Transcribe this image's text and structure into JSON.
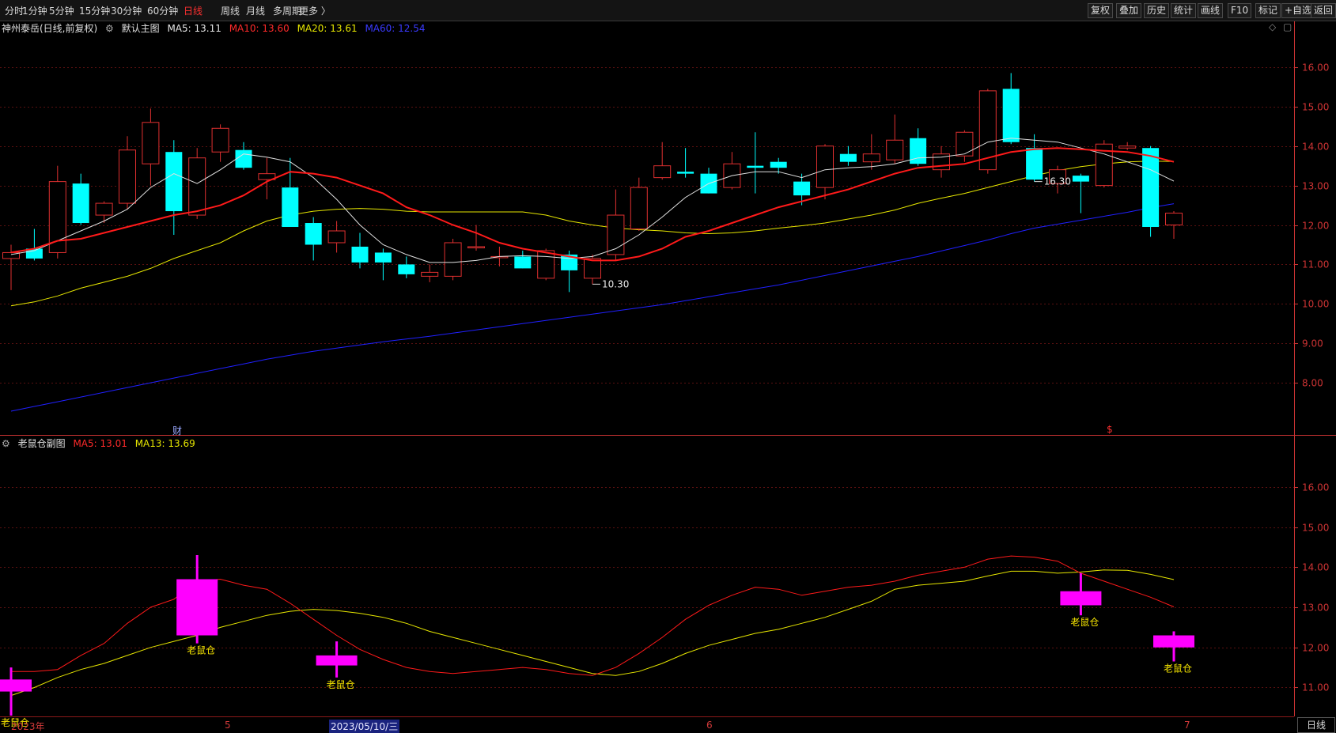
{
  "toolbar": {
    "left_items": [
      "分时",
      "1分钟",
      "5分钟",
      "15分钟",
      "30分钟",
      "60分钟",
      "日线",
      "周线",
      "月线",
      "多周期",
      "更多 〉"
    ],
    "active_index": 6,
    "right_items": [
      "复权",
      "叠加",
      "历史",
      "统计",
      "画线",
      "F10",
      "标记",
      "+自选",
      "返回"
    ]
  },
  "main_info": {
    "stock": "神州泰岳(日线,前复权)",
    "view": "默认主图",
    "ma5": "MA5: 13.11",
    "ma10": "MA10: 13.60",
    "ma20": "MA20: 13.61",
    "ma60": "MA60: 12.54"
  },
  "sub_info": {
    "name": "老鼠仓副图",
    "ma5": "MA5: 13.01",
    "ma13": "MA13: 13.69"
  },
  "markers": {
    "cai": "财",
    "dollar": "$"
  },
  "datebar": {
    "labels": [
      "2023年",
      "5",
      "2023/05/10/三",
      "6",
      "7"
    ],
    "right_button": "日线"
  },
  "colors": {
    "up": "#e03030",
    "down": "#00ffff",
    "ma5": "#e0e0e0",
    "ma10": "#ff1a1a",
    "ma20": "#e6e600",
    "ma60": "#2020ff",
    "signal": "#ff00ff",
    "axis": "#cc3333",
    "signal_text": "#f5e400"
  },
  "chart_data": [
    {
      "type": "candlestick",
      "y_range": [
        7.0,
        16.7
      ],
      "y_ticks": [
        "16.00",
        "15.00",
        "14.00",
        "13.00",
        "12.00",
        "11.00",
        "10.00",
        "9.00",
        "8.00"
      ],
      "grid": true,
      "annotations": [
        {
          "index": 44,
          "label": "16.30"
        },
        {
          "index": 25,
          "label": "10.30"
        }
      ],
      "candles": [
        [
          11.15,
          11.5,
          10.35,
          11.3
        ],
        [
          11.4,
          11.9,
          11.1,
          11.15
        ],
        [
          11.3,
          13.5,
          11.15,
          13.1
        ],
        [
          13.05,
          13.3,
          12.0,
          12.05
        ],
        [
          12.25,
          12.6,
          12.05,
          12.55
        ],
        [
          12.55,
          14.25,
          12.4,
          13.9
        ],
        [
          13.55,
          14.95,
          13.0,
          14.6
        ],
        [
          13.85,
          14.15,
          11.75,
          12.35
        ],
        [
          12.25,
          13.95,
          12.15,
          13.7
        ],
        [
          13.85,
          14.55,
          13.6,
          14.45
        ],
        [
          13.9,
          14.1,
          13.4,
          13.45
        ],
        [
          13.15,
          13.7,
          12.65,
          13.3
        ],
        [
          12.95,
          13.7,
          11.95,
          11.95
        ],
        [
          12.05,
          12.2,
          11.1,
          11.5
        ],
        [
          11.55,
          12.1,
          11.3,
          11.85
        ],
        [
          11.45,
          11.8,
          10.9,
          11.05
        ],
        [
          11.3,
          11.4,
          10.6,
          11.05
        ],
        [
          11.0,
          11.2,
          10.65,
          10.75
        ],
        [
          10.7,
          11.0,
          10.55,
          10.8
        ],
        [
          10.7,
          11.65,
          10.6,
          11.55
        ],
        [
          11.45,
          12.0,
          11.35,
          11.45
        ],
        [
          11.2,
          11.45,
          10.95,
          11.2
        ],
        [
          11.2,
          11.35,
          10.9,
          10.9
        ],
        [
          10.65,
          11.4,
          10.6,
          11.35
        ],
        [
          11.25,
          11.35,
          10.3,
          10.85
        ],
        [
          10.65,
          11.25,
          10.5,
          11.15
        ],
        [
          11.25,
          12.9,
          11.1,
          12.25
        ],
        [
          11.9,
          13.2,
          11.85,
          12.95
        ],
        [
          13.2,
          14.1,
          13.15,
          13.5
        ],
        [
          13.35,
          13.95,
          13.2,
          13.3
        ],
        [
          13.3,
          13.45,
          12.8,
          12.8
        ],
        [
          12.95,
          13.85,
          12.9,
          13.55
        ],
        [
          13.5,
          14.35,
          12.8,
          13.45
        ],
        [
          13.6,
          13.7,
          13.3,
          13.45
        ],
        [
          13.1,
          13.3,
          12.5,
          12.75
        ],
        [
          12.95,
          14.05,
          12.65,
          14.0
        ],
        [
          13.8,
          14.0,
          13.5,
          13.6
        ],
        [
          13.6,
          14.3,
          13.4,
          13.8
        ],
        [
          13.65,
          14.8,
          13.55,
          14.15
        ],
        [
          14.2,
          14.45,
          13.5,
          13.55
        ],
        [
          13.4,
          14.0,
          13.2,
          13.8
        ],
        [
          13.75,
          14.4,
          13.6,
          14.35
        ],
        [
          13.4,
          15.45,
          13.3,
          15.4
        ],
        [
          15.45,
          15.85,
          14.05,
          14.1
        ],
        [
          13.95,
          14.3,
          13.1,
          13.15
        ],
        [
          13.05,
          13.5,
          12.8,
          13.4
        ],
        [
          13.25,
          13.3,
          12.3,
          13.1
        ],
        [
          13.0,
          14.15,
          12.95,
          14.05
        ],
        [
          13.95,
          14.1,
          13.9,
          14.0
        ],
        [
          13.95,
          14.0,
          11.7,
          11.95
        ],
        [
          12.0,
          12.35,
          11.65,
          12.3
        ]
      ],
      "ma5": [
        11.25,
        11.35,
        11.6,
        11.85,
        12.1,
        12.4,
        12.95,
        13.3,
        13.05,
        13.4,
        13.8,
        13.72,
        13.6,
        13.2,
        12.65,
        12.0,
        11.5,
        11.25,
        11.05,
        11.05,
        11.1,
        11.2,
        11.22,
        11.2,
        11.15,
        11.2,
        11.4,
        11.75,
        12.2,
        12.7,
        13.05,
        13.25,
        13.35,
        13.35,
        13.2,
        13.4,
        13.45,
        13.48,
        13.55,
        13.7,
        13.72,
        13.8,
        14.1,
        14.2,
        14.15,
        14.1,
        13.95,
        13.8,
        13.6,
        13.4,
        13.11
      ],
      "ma10": [
        11.3,
        11.4,
        11.6,
        11.65,
        11.8,
        11.95,
        12.1,
        12.25,
        12.35,
        12.5,
        12.75,
        13.1,
        13.35,
        13.3,
        13.2,
        13.0,
        12.8,
        12.45,
        12.25,
        12.0,
        11.8,
        11.55,
        11.4,
        11.3,
        11.2,
        11.1,
        11.1,
        11.2,
        11.4,
        11.7,
        11.85,
        12.05,
        12.25,
        12.45,
        12.6,
        12.75,
        12.9,
        13.1,
        13.3,
        13.45,
        13.5,
        13.55,
        13.7,
        13.85,
        13.92,
        13.95,
        13.92,
        13.88,
        13.85,
        13.75,
        13.6
      ],
      "ma20": [
        9.95,
        10.05,
        10.2,
        10.4,
        10.55,
        10.7,
        10.9,
        11.15,
        11.35,
        11.55,
        11.85,
        12.1,
        12.25,
        12.35,
        12.4,
        12.42,
        12.4,
        12.35,
        12.33,
        12.33,
        12.33,
        12.33,
        12.33,
        12.25,
        12.1,
        12.0,
        11.92,
        11.88,
        11.85,
        11.8,
        11.78,
        11.8,
        11.85,
        11.92,
        11.98,
        12.05,
        12.15,
        12.25,
        12.38,
        12.55,
        12.68,
        12.8,
        12.95,
        13.1,
        13.25,
        13.38,
        13.48,
        13.55,
        13.6,
        13.62,
        13.61
      ],
      "ma60": [
        7.28,
        7.4,
        7.52,
        7.64,
        7.76,
        7.88,
        8.0,
        8.12,
        8.24,
        8.36,
        8.48,
        8.6,
        8.7,
        8.8,
        8.88,
        8.96,
        9.04,
        9.11,
        9.18,
        9.26,
        9.34,
        9.42,
        9.5,
        9.58,
        9.66,
        9.74,
        9.82,
        9.9,
        9.98,
        10.08,
        10.18,
        10.28,
        10.38,
        10.48,
        10.6,
        10.72,
        10.84,
        10.96,
        11.08,
        11.2,
        11.34,
        11.48,
        11.62,
        11.78,
        11.92,
        12.02,
        12.12,
        12.22,
        12.32,
        12.44,
        12.54
      ]
    },
    {
      "type": "indicator",
      "name": "老鼠仓副图",
      "y_range": [
        10.3,
        17.1
      ],
      "y_ticks": [
        "16.00",
        "15.00",
        "14.00",
        "13.00",
        "12.00",
        "11.00"
      ],
      "grid": true,
      "ma5": [
        11.4,
        11.4,
        11.45,
        11.8,
        12.1,
        12.6,
        13.0,
        13.2,
        13.65,
        13.7,
        13.55,
        13.45,
        13.1,
        12.7,
        12.3,
        11.95,
        11.7,
        11.5,
        11.4,
        11.35,
        11.4,
        11.45,
        11.5,
        11.45,
        11.35,
        11.3,
        11.5,
        11.85,
        12.25,
        12.7,
        13.05,
        13.3,
        13.5,
        13.45,
        13.3,
        13.4,
        13.5,
        13.55,
        13.65,
        13.8,
        13.9,
        14.0,
        14.2,
        14.28,
        14.25,
        14.15,
        13.85,
        13.65,
        13.45,
        13.25,
        13.01
      ],
      "ma13": [
        10.8,
        11.0,
        11.25,
        11.45,
        11.6,
        11.8,
        12.0,
        12.15,
        12.3,
        12.5,
        12.65,
        12.8,
        12.9,
        12.95,
        12.92,
        12.85,
        12.75,
        12.6,
        12.4,
        12.25,
        12.1,
        11.95,
        11.8,
        11.65,
        11.5,
        11.35,
        11.3,
        11.4,
        11.6,
        11.85,
        12.05,
        12.2,
        12.35,
        12.45,
        12.6,
        12.75,
        12.95,
        13.15,
        13.45,
        13.55,
        13.6,
        13.65,
        13.78,
        13.9,
        13.9,
        13.85,
        13.88,
        13.93,
        13.92,
        13.82,
        13.69
      ],
      "signals": [
        {
          "index": 0,
          "open": 11.2,
          "close": 10.9,
          "high": 11.5,
          "low": 10.3,
          "label": "老鼠仓"
        },
        {
          "index": 8,
          "open": 12.3,
          "close": 13.7,
          "high": 14.3,
          "low": 12.1,
          "label": "老鼠仓"
        },
        {
          "index": 14,
          "open": 11.8,
          "close": 11.55,
          "high": 12.15,
          "low": 11.25,
          "label": "老鼠仓"
        },
        {
          "index": 46,
          "open": 13.05,
          "close": 13.4,
          "high": 13.85,
          "low": 12.8,
          "label": "老鼠仓"
        },
        {
          "index": 50,
          "open": 12.0,
          "close": 12.3,
          "high": 12.4,
          "low": 11.65,
          "label": "老鼠仓"
        }
      ]
    }
  ]
}
